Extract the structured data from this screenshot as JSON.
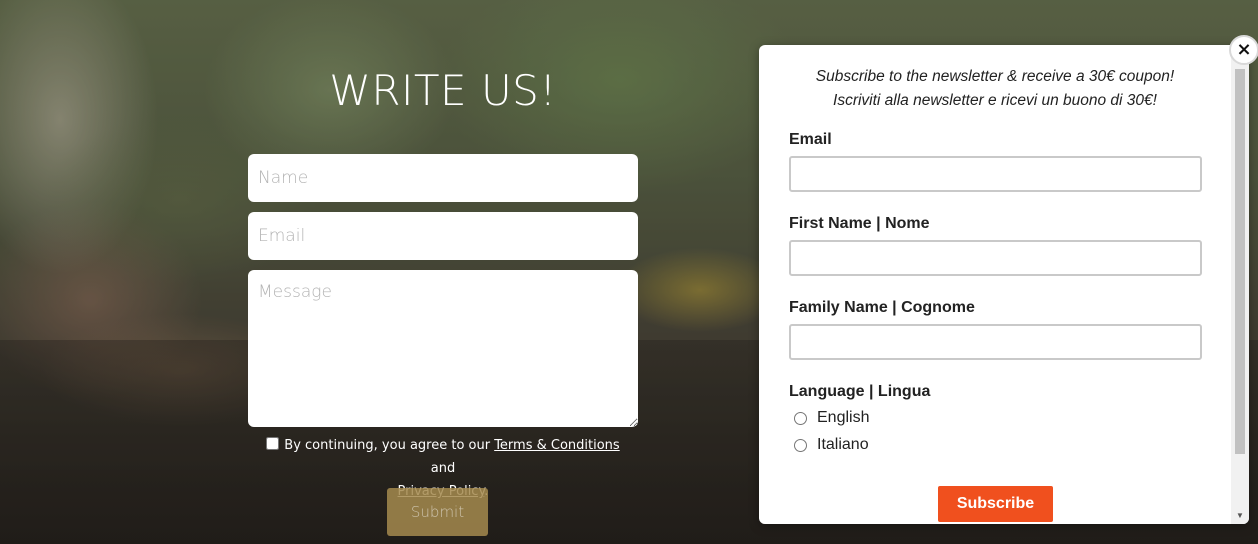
{
  "contact": {
    "title": "WRITE US!",
    "name_placeholder": "Name",
    "email_placeholder": "Email",
    "message_placeholder": "Message",
    "consent_prefix": "By continuing, you agree to our ",
    "terms_link": "Terms & Conditions",
    "consent_middle": " and",
    "privacy_link": "Privacy Policy",
    "consent_suffix": ".",
    "submit_label": "Submit"
  },
  "newsletter": {
    "promo_en": "Subscribe to the newsletter & receive a 30€ coupon!",
    "promo_it": "Iscriviti alla newsletter e ricevi un buono di 30€!",
    "email_label": "Email",
    "first_name_label": "First Name | Nome",
    "family_name_label": "Family Name | Cognome",
    "language_label": "Language | Lingua",
    "language_options": [
      "English",
      "Italiano"
    ],
    "subscribe_label": "Subscribe",
    "close_icon": "×"
  },
  "colors": {
    "subscribe_button": "#f0501e",
    "submit_button": "#a58a4e"
  }
}
